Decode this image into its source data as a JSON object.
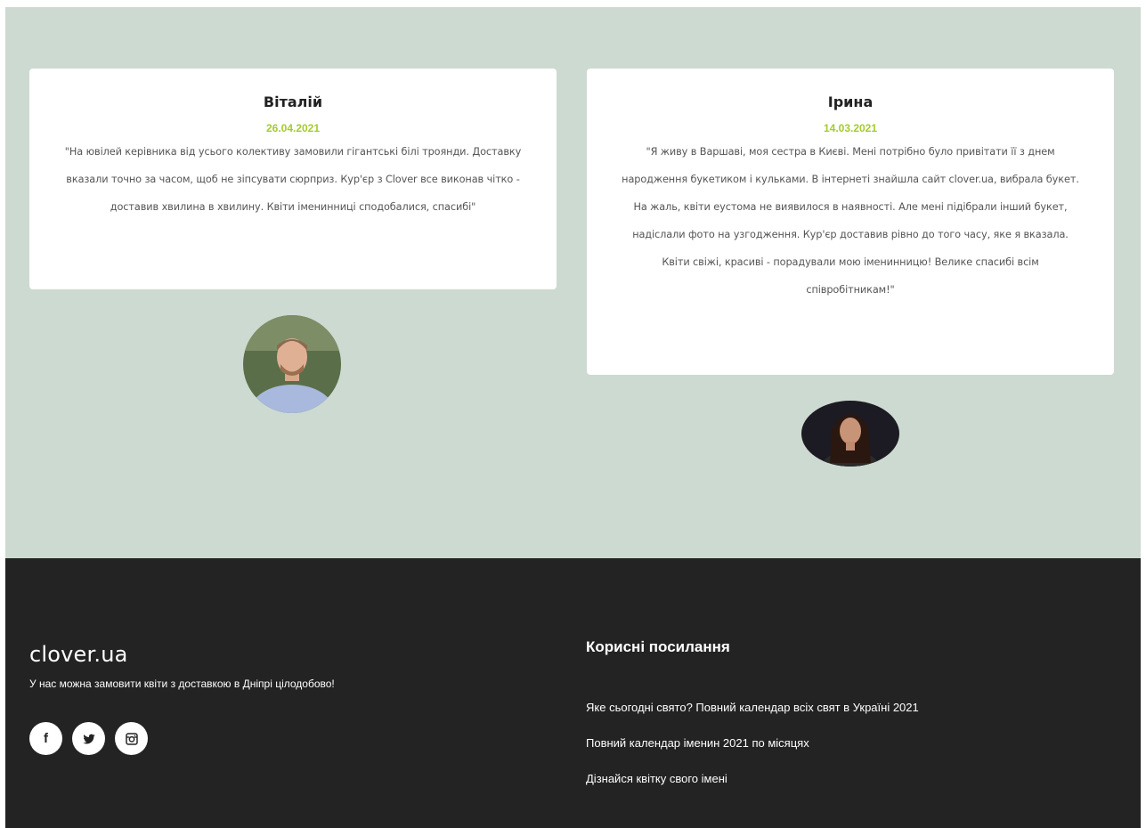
{
  "reviews": [
    {
      "name": "Віталій",
      "date": "26.04.2021",
      "text": "\"На ювілей керівника від усього колективу замовили гігантські білі троянди. Доставку вказали точно за часом, щоб не зіпсувати сюрприз. Кур'єр з Clover все виконав чітко - доставив хвилина в хвилину. Квіти іменинниці сподобалися, спасибі\""
    },
    {
      "name": "Ірина",
      "date": "14.03.2021",
      "text": "\"Я живу в Варшаві, моя сестра в Києві. Мені потрібно було привітати її з днем народження букетиком і кульками. В інтернеті знайшла сайт clover.ua, вибрала букет. На жаль, квіти еустома не виявилося в наявності. Але мені підібрали інший букет, надіслали фото на узгодження. Кур'єр доставив рівно до того часу, яке я вказала. Квіти свіжі, красиві - порадували мою іменинницю! Велике спасибі всім співробітникам!\""
    }
  ],
  "footer": {
    "brand": "clover.ua",
    "tagline": "У нас можна замовити квіти з доставкою в Дніпрі цілодобово!",
    "socials": [
      {
        "icon": "facebook-icon",
        "glyph": "f"
      },
      {
        "icon": "twitter-icon"
      },
      {
        "icon": "instagram-icon"
      }
    ],
    "links_title": "Корисні посилання",
    "links": [
      "Яке сьогодні свято? Повний календар всіх свят в Україні 2021",
      "Повний календар іменин 2021 по місяцях",
      "Дізнайся квітку свого імені"
    ]
  },
  "colors": {
    "section_bg": "#cddad1",
    "footer_bg": "#232323",
    "date_accent": "#a3cc2d"
  }
}
